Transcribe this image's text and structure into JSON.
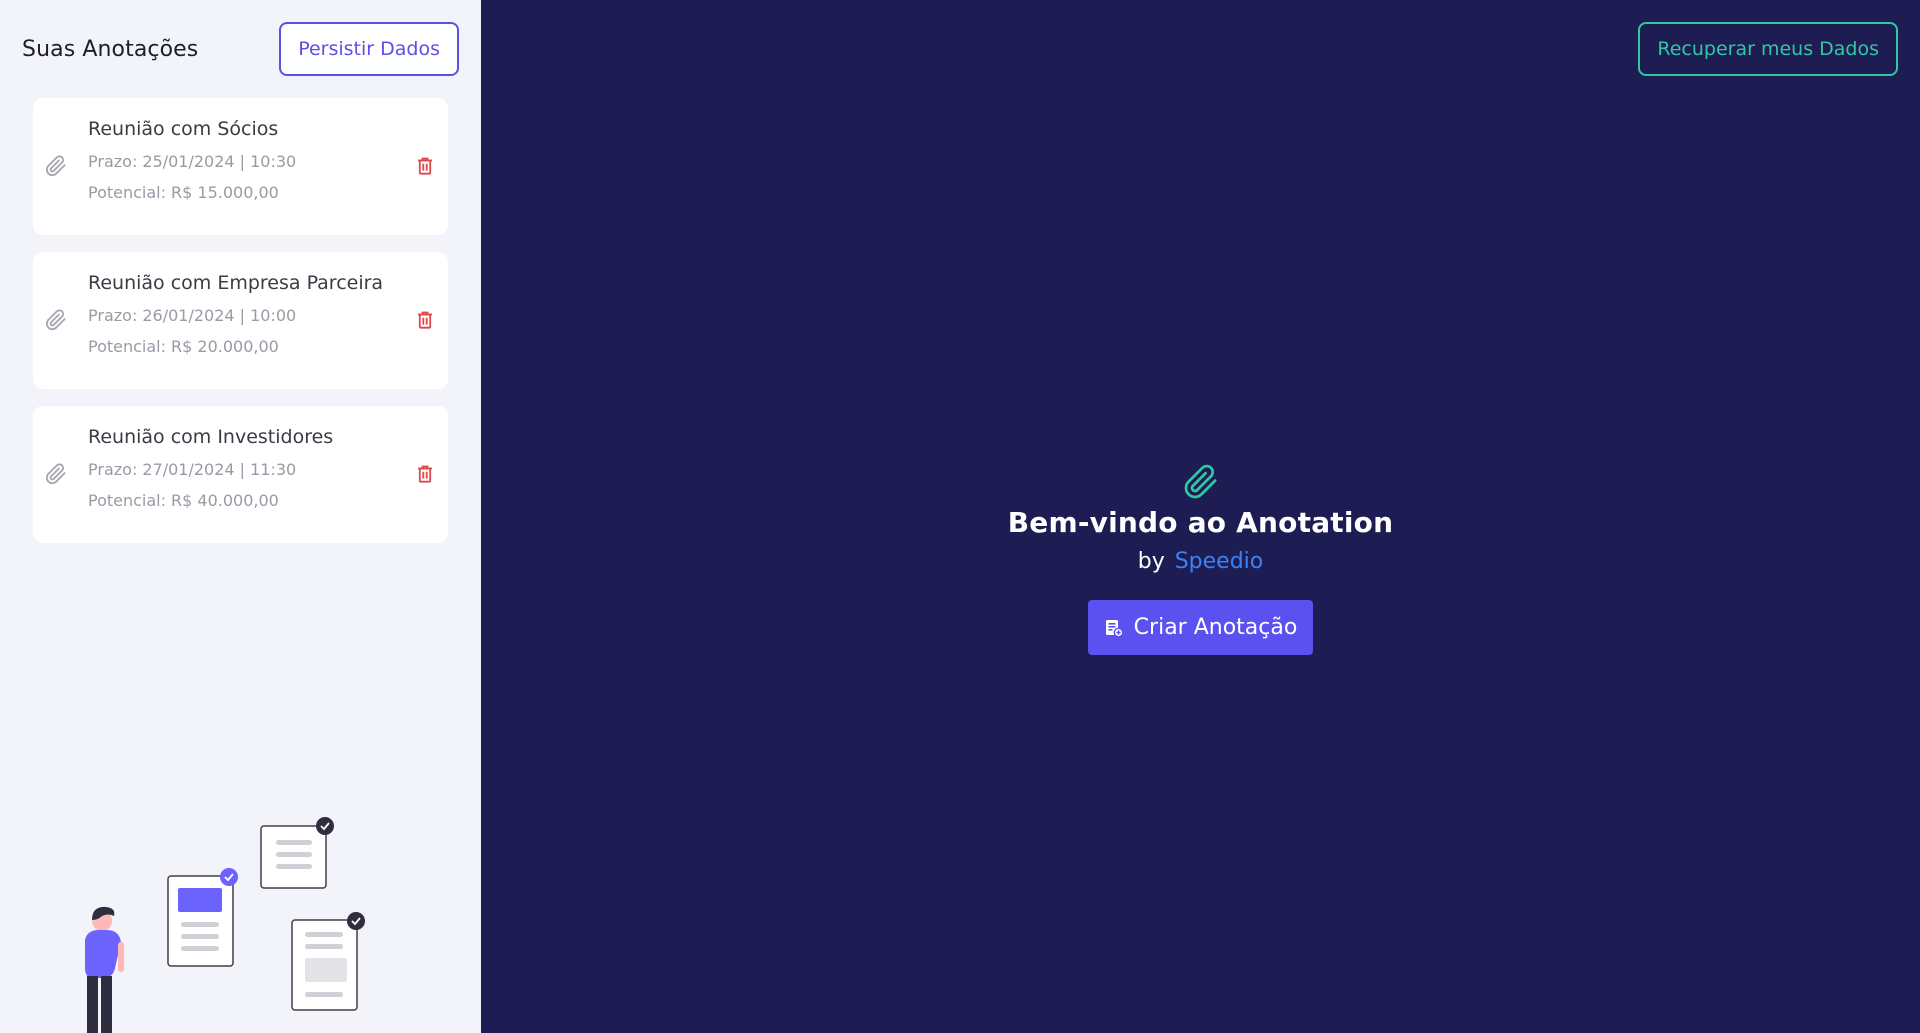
{
  "sidebar": {
    "title": "Suas Anotações",
    "persist_button": "Persistir Dados",
    "notes": [
      {
        "title": "Reunião com Sócios",
        "prazo_label": "Prazo:",
        "prazo_value": "25/01/2024 | 10:30",
        "potencial_label": "Potencial:",
        "potencial_value": "R$ 15.000,00"
      },
      {
        "title": "Reunião com Empresa Parceira",
        "prazo_label": "Prazo:",
        "prazo_value": "26/01/2024 | 10:00",
        "potencial_label": "Potencial:",
        "potencial_value": "R$ 20.000,00"
      },
      {
        "title": "Reunião com Investidores",
        "prazo_label": "Prazo:",
        "prazo_value": "27/01/2024 | 11:30",
        "potencial_label": "Potencial:",
        "potencial_value": "R$ 40.000,00"
      }
    ],
    "note_icon": "paperclip-icon",
    "delete_icon": "trash-icon"
  },
  "main": {
    "recover_button": "Recuperar meus Dados",
    "welcome_icon": "paperclip-icon",
    "welcome_title": "Bem-vindo ao Anotation",
    "by_label": "by",
    "brand": "Speedio",
    "create_button": "Criar Anotação",
    "create_icon": "note-add-icon"
  },
  "colors": {
    "sidebar_bg": "#f3f4fa",
    "main_bg": "#1d1d53",
    "accent_purple": "#5b50e6",
    "accent_green": "#2fc9a1",
    "brand_blue": "#3b82f6",
    "delete_red": "#e0484b"
  }
}
